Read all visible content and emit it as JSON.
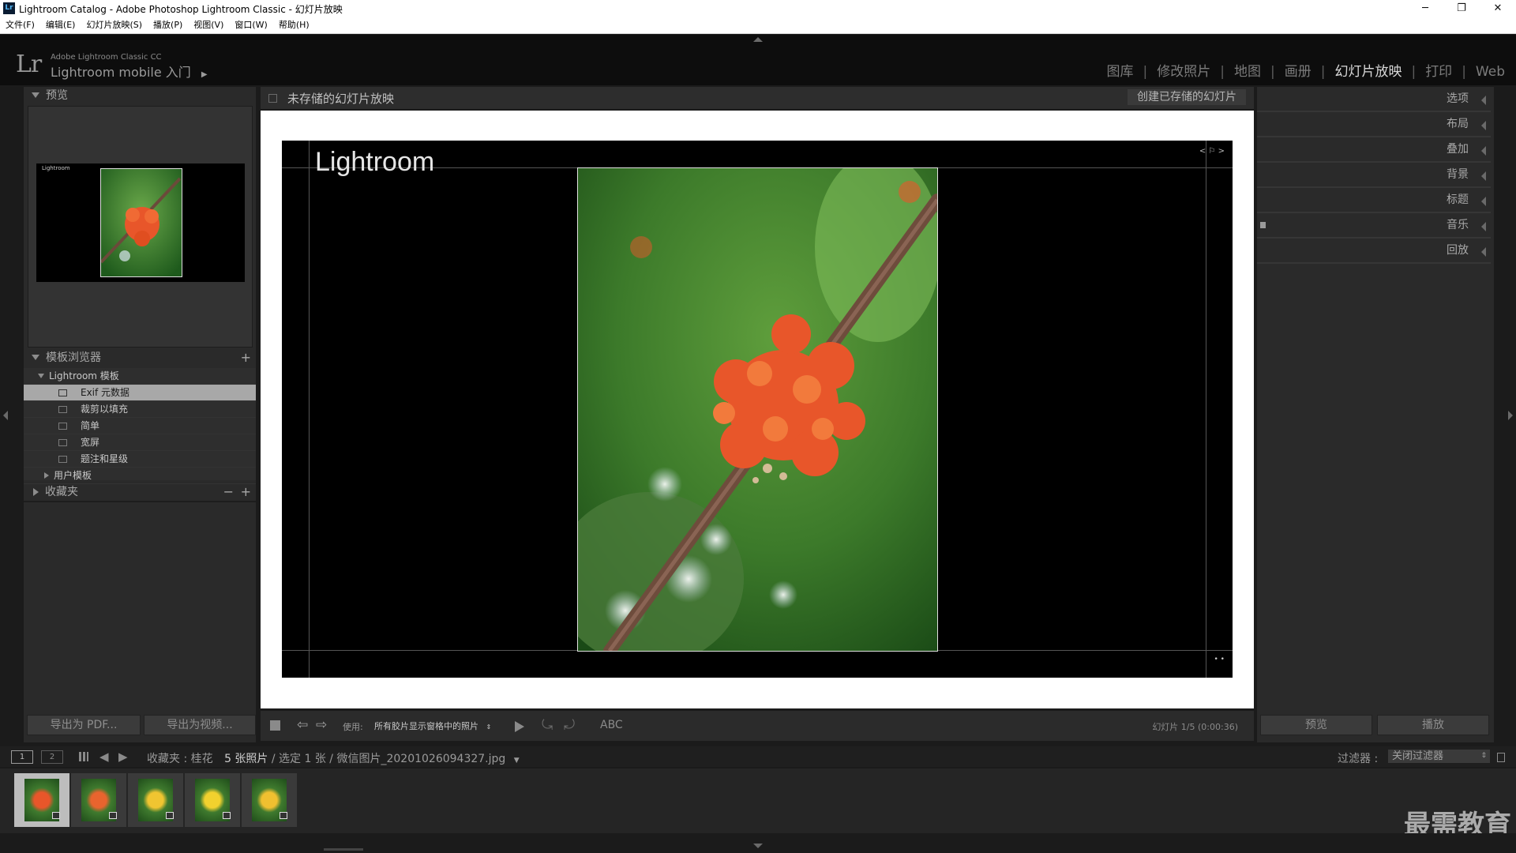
{
  "window": {
    "badge": "Lr",
    "title": "Lightroom Catalog - Adobe Photoshop Lightroom Classic - 幻灯片放映",
    "controls": [
      "─",
      "❐",
      "✕"
    ]
  },
  "menu": [
    "文件(F)",
    "编辑(E)",
    "幻灯片放映(S)",
    "播放(P)",
    "视图(V)",
    "窗口(W)",
    "帮助(H)"
  ],
  "identity": {
    "logo": "Lr",
    "small": "Adobe Lightroom Classic CC",
    "big": "Lightroom mobile 入门",
    "arrow": "▶"
  },
  "modules": [
    {
      "label": "图库",
      "active": false
    },
    {
      "label": "修改照片",
      "active": false
    },
    {
      "label": "地图",
      "active": false
    },
    {
      "label": "画册",
      "active": false
    },
    {
      "label": "幻灯片放映",
      "active": true
    },
    {
      "label": "打印",
      "active": false
    },
    {
      "label": "Web",
      "active": false
    }
  ],
  "left_panel": {
    "preview_title": "预览",
    "preview_mini_label": "Lightroom",
    "template_browser_title": "模板浏览器",
    "add": "+",
    "template_group": "Lightroom 模板",
    "templates": [
      {
        "label": "Exif 元数据",
        "selected": true
      },
      {
        "label": "裁剪以填充",
        "selected": false
      },
      {
        "label": "简单",
        "selected": false
      },
      {
        "label": "宽屏",
        "selected": false
      },
      {
        "label": "题注和星级",
        "selected": false
      }
    ],
    "user_templates": "用户模板",
    "collections_title": "收藏夹",
    "collections_minus": "−",
    "collections_plus": "+",
    "export_pdf": "导出为 PDF...",
    "export_video": "导出为视频..."
  },
  "center": {
    "unsaved_title": "未存储的幻灯片放映",
    "create_saved": "创建已存储的幻灯片",
    "identity_plate_text": "Lightroom",
    "nav_glyph": "< ⚐ >",
    "dots": "• •"
  },
  "toolbar": {
    "use_label": "使用:",
    "use_value": "所有胶片显示窗格中的照片",
    "abc": "ABC",
    "slide_info": "幻灯片 1/5 (0:00:36)"
  },
  "right_panel": {
    "sections": [
      "选项",
      "布局",
      "叠加",
      "背景",
      "标题",
      "音乐",
      "回放"
    ],
    "preview_button": "预览",
    "play_button": "播放"
  },
  "filmstrip_nav": {
    "page1": "1",
    "page2": "2",
    "source_prefix": "收藏夹 : ",
    "source_name": "桂花",
    "count": "5 张照片",
    "selection": " / 选定 1 张 / 微信图片_20201026094327.jpg",
    "filter_label": "过滤器 :",
    "filter_value": "关闭过滤器"
  },
  "thumbnails": [
    {
      "flower_color": "#e8562a",
      "selected": true
    },
    {
      "flower_color": "#e8642e",
      "selected": false
    },
    {
      "flower_color": "#f0c531",
      "selected": false
    },
    {
      "flower_color": "#f2d12e",
      "selected": false
    },
    {
      "flower_color": "#f0c030",
      "selected": false
    }
  ],
  "watermark": "最需教育",
  "colors": {
    "active_module": "#d9d9d9",
    "inactive_module": "#7c7c7c",
    "selected_template": "#a8a8a8"
  }
}
